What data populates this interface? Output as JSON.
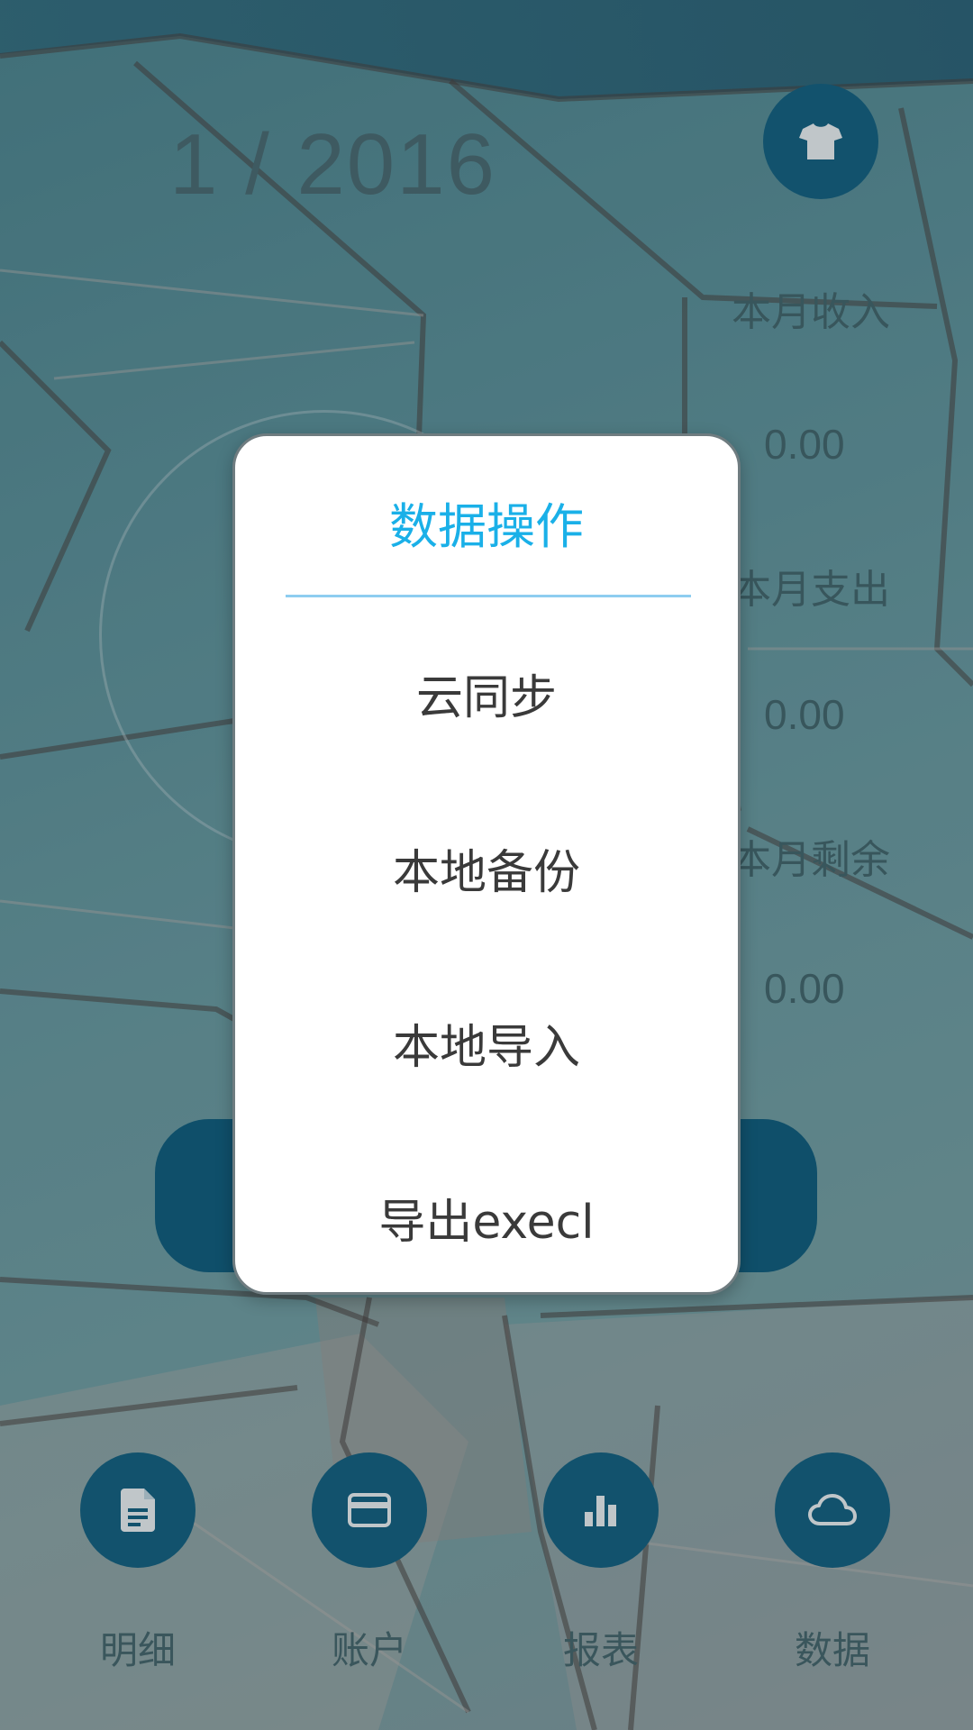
{
  "header": {
    "month_year": "1 / 2016",
    "theme_icon": "tshirt-icon"
  },
  "stats": {
    "income_label": "本月收入",
    "income_value": "0.00",
    "expense_label": "本月支出",
    "expense_value": "0.00",
    "balance_label": "本月剩余",
    "balance_value": "0.00"
  },
  "bottom_nav": [
    {
      "label": "明细",
      "icon": "document-icon"
    },
    {
      "label": "账户",
      "icon": "card-icon"
    },
    {
      "label": "报表",
      "icon": "bar-chart-icon"
    },
    {
      "label": "数据",
      "icon": "cloud-icon"
    }
  ],
  "dialog": {
    "title": "数据操作",
    "options": [
      "云同步",
      "本地备份",
      "本地导入",
      "导出execl"
    ]
  },
  "colors": {
    "accent": "#1ab0e8",
    "fab": "#0f5f80",
    "divider": "#8ecdf0"
  }
}
